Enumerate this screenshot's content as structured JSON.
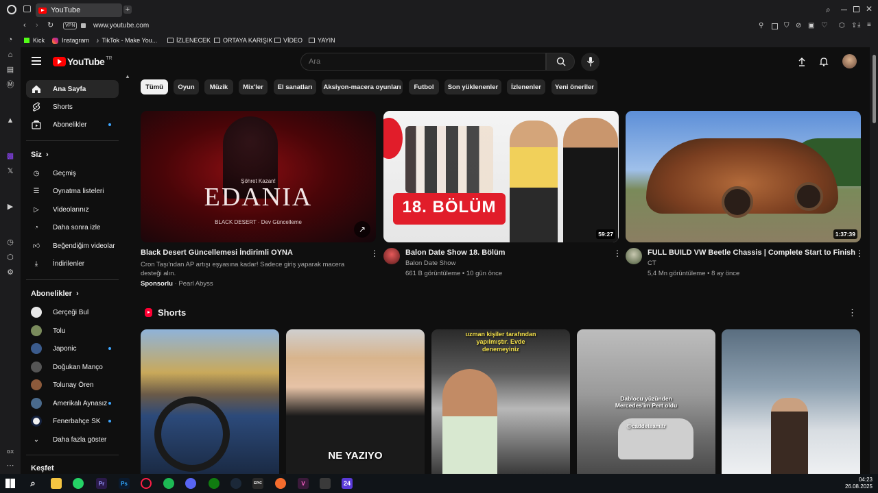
{
  "browser": {
    "tab_title": "YouTube",
    "url": "www.youtube.com",
    "vpn_label": "VPN",
    "bookmarks": [
      "Kick",
      "Instagram",
      "TikTok - Make You...",
      "İZLENECEK",
      "ORTAYA KARIŞIK",
      "VİDEO",
      "YAYIN"
    ],
    "gx_label": "GX"
  },
  "header": {
    "logo_text": "YouTube",
    "logo_region": "TR",
    "search_placeholder": "Ara"
  },
  "sidebar": {
    "main": [
      "Ana Sayfa",
      "Shorts",
      "Abonelikler"
    ],
    "you_heading": "Siz",
    "you_items": [
      "Geçmiş",
      "Oynatma listeleri",
      "Videolarınız",
      "Daha sonra izle",
      "Beğendiğim videolar",
      "İndirilenler"
    ],
    "subs_heading": "Abonelikler",
    "subs": [
      "Gerçeği Bul",
      "Tolu",
      "Japonic",
      "Doğukan Manço",
      "Tolunay Ören",
      "Amerikalı Aynasız",
      "Fenerbahçe SK"
    ],
    "show_more": "Daha fazla göster",
    "explore_heading": "Keşfet"
  },
  "chips": [
    "Tümü",
    "Oyun",
    "Müzik",
    "Mix'ler",
    "El sanatları",
    "Aksiyon-macera oyunları",
    "Futbol",
    "Son yüklenenler",
    "İzlenenler",
    "Yeni öneriler"
  ],
  "videos": [
    {
      "title": "Black Desert Güncellemesi İndirimli OYNA",
      "desc": "Cron Taşı'ndan AP artışı eşyasına kadar! Sadece giriş yaparak macera desteği alın.",
      "sponsored": "Sponsorlu",
      "advertiser": "· Pearl Abyss",
      "thumb_small": "Şöhret Kazan!",
      "thumb_big": "EDANIA",
      "thumb_footer": "BLACK DESERT · Dev Güncelleme"
    },
    {
      "title": "Balon Date Show 18. Bölüm",
      "channel": "Balon Date Show",
      "meta": "661 B görüntüleme • 10 gün önce",
      "duration": "59:27",
      "thumb_text": "18. BÖLÜM"
    },
    {
      "title": "FULL BUILD VW Beetle Chassis | Complete Start to Finish",
      "channel": "CT",
      "meta": "5,4 Mn görüntüleme • 8 ay önce",
      "duration": "1:37:39"
    }
  ],
  "shorts": {
    "heading": "Shorts",
    "items": [
      {
        "text": ""
      },
      {
        "text": "NE YAZIYO"
      },
      {
        "text": "uzman kişiler tarafından yapılmıştır. Evde denemeyiniz"
      },
      {
        "text": "Dablocu yüzünden Mercedes'im Pert oldu",
        "sub": "@caddeteam.tr"
      },
      {
        "text": ""
      }
    ]
  },
  "taskbar": {
    "time": "04:23",
    "date": "26.08.2025"
  }
}
